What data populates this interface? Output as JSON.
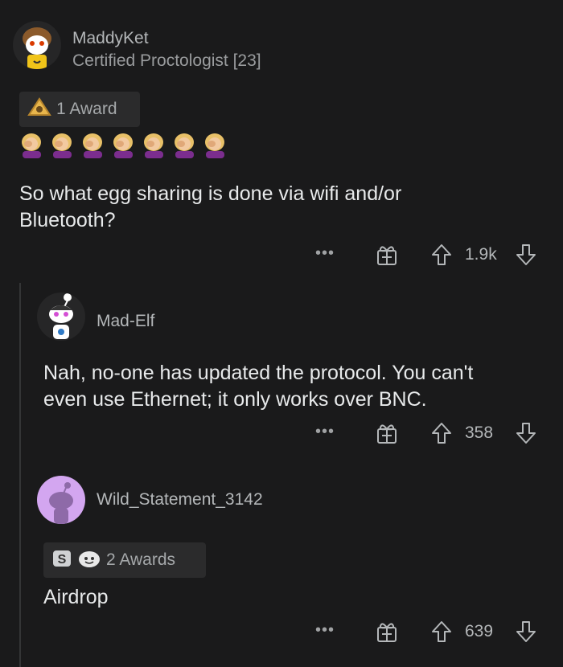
{
  "comments": [
    {
      "username": "MaddyKet",
      "flair": "Certified Proctologist [23]",
      "awards_label": "1 Award",
      "body": "So what egg sharing is done via wifi and/or\nBluetooth?",
      "more_label": "•••",
      "score": "1.9k"
    },
    {
      "username": "Mad-Elf",
      "body": "Nah, no-one has updated the protocol. You can't\neven use Ethernet; it only works over BNC.",
      "more_label": "•••",
      "score": "358"
    },
    {
      "username": "Wild_Statement_3142",
      "awards_label": "2 Awards",
      "body": "Airdrop",
      "more_label": "•••",
      "score": "639"
    }
  ],
  "icons": {
    "award": "award-icon",
    "gift": "gift-icon",
    "upvote": "upvote-icon",
    "downvote": "downvote-icon",
    "more": "more-options-icon"
  },
  "colors": {
    "background": "#1a1a1b",
    "text": "#d7dadc",
    "muted": "#9a9c9e",
    "award_bg": "#2b2b2c",
    "avatar_purple": "#d3a6f0"
  }
}
